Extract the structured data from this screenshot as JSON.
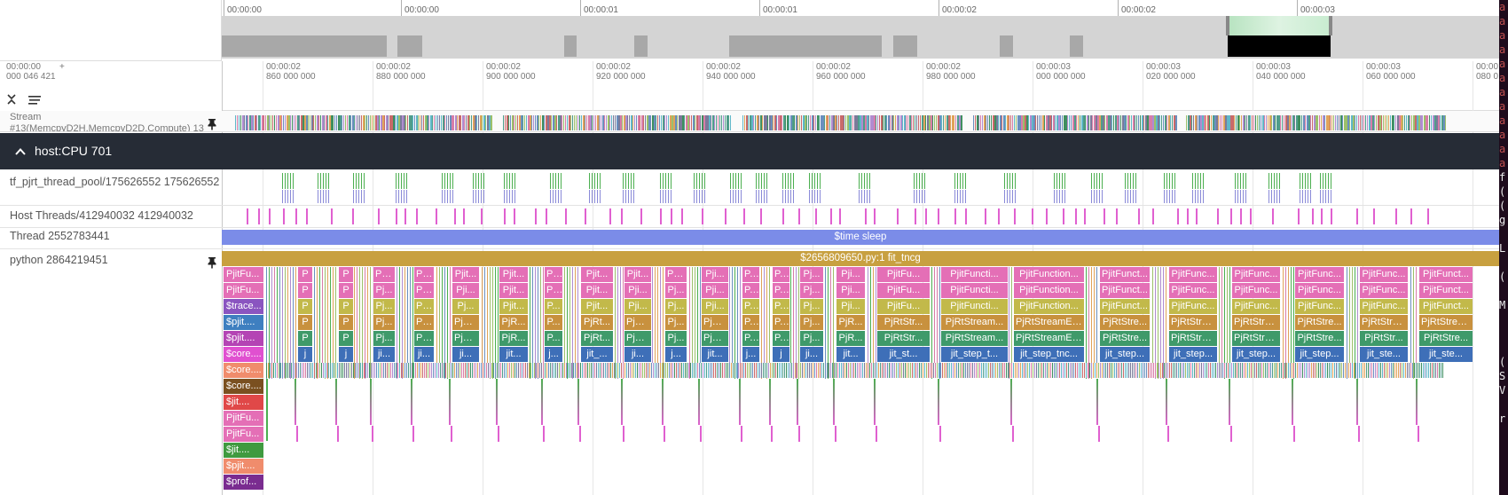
{
  "overview": {
    "ticks": [
      "00:00:00",
      "00:00:00",
      "00:00:01",
      "00:00:01",
      "00:00:02",
      "00:00:02",
      "00:00:03"
    ]
  },
  "ruler": {
    "origin_time": "00:00:00",
    "origin_ns": "000 046 421",
    "plus": "+",
    "labels": [
      {
        "t": "00:00:02",
        "ns": "860 000 000"
      },
      {
        "t": "00:00:02",
        "ns": "880 000 000"
      },
      {
        "t": "00:00:02",
        "ns": "900 000 000"
      },
      {
        "t": "00:00:02",
        "ns": "920 000 000"
      },
      {
        "t": "00:00:02",
        "ns": "940 000 000"
      },
      {
        "t": "00:00:02",
        "ns": "960 000 000"
      },
      {
        "t": "00:00:02",
        "ns": "980 000 000"
      },
      {
        "t": "00:00:03",
        "ns": "000 000 000"
      },
      {
        "t": "00:00:03",
        "ns": "020 000 000"
      },
      {
        "t": "00:00:03",
        "ns": "040 000 000"
      },
      {
        "t": "00:00:03",
        "ns": "060 000 000"
      },
      {
        "t": "00:00:03",
        "ns": "080 0"
      }
    ]
  },
  "tracks": {
    "stream_label": "Stream #13(MemcpyD2H,MemcpyD2D,Compute) 13",
    "group_title": "host:CPU 701",
    "thread_pool": "tf_pjrt_thread_pool/175626552 175626552",
    "host_threads": "Host Threads/412940032 412940032",
    "thread": "Thread 2552783441",
    "python": "python 2864219451"
  },
  "slices": {
    "sleep": "$time sleep",
    "fit": "$2656809650.py:1 fit_tncg",
    "left_column": [
      "PjitFu...",
      "PjitFu...",
      "$trace...",
      "$pjit....",
      "$pjit....",
      "$core....",
      "$core....",
      "$core....",
      "$jit....",
      "PjitFu...",
      "PjitFu...",
      "$jit....",
      "$pjit....",
      "$prof..."
    ],
    "blocks": [
      {
        "r0": "P",
        "r1": "P",
        "r2": "P",
        "r3": "P",
        "r4": "P",
        "r5": "j"
      },
      {
        "r0": "P",
        "r1": "P",
        "r2": "P",
        "r3": "P",
        "r4": "P",
        "r5": "j"
      },
      {
        "r0": "Pjit...",
        "r1": "Pj...",
        "r2": "Pj...",
        "r3": "Pj...",
        "r4": "Pj...",
        "r5": "ji..."
      },
      {
        "r0": "Pj...",
        "r1": "Pj...",
        "r2": "Pj...",
        "r3": "Pj...",
        "r4": "Pj...",
        "r5": "ji..."
      },
      {
        "r0": "Pjit...",
        "r1": "Pji...",
        "r2": "Pj...",
        "r3": "PjR...",
        "r4": "PjR...",
        "r5": "ji..."
      },
      {
        "r0": "Pjit...",
        "r1": "Pjit...",
        "r2": "Pjit...",
        "r3": "PjR...",
        "r4": "PjR...",
        "r5": "jit..."
      },
      {
        "r0": "Pji...",
        "r1": "Pji...",
        "r2": "P...",
        "r3": "P...",
        "r4": "P...",
        "r5": "j..."
      },
      {
        "r0": "Pjit...",
        "r1": "Pjit...",
        "r2": "Pjit...",
        "r3": "PjRt...",
        "r4": "PjRt...",
        "r5": "jit_..."
      },
      {
        "r0": "Pjit...",
        "r1": "Pji...",
        "r2": "Pji...",
        "r3": "PjR...",
        "r4": "PjR...",
        "r5": "ji..."
      },
      {
        "r0": "Pji...",
        "r1": "Pj...",
        "r2": "Pj...",
        "r3": "Pj...",
        "r4": "Pj...",
        "r5": "j..."
      },
      {
        "r0": "Pji...",
        "r1": "Pji...",
        "r2": "Pji...",
        "r3": "PjR...",
        "r4": "PjR...",
        "r5": "jit..."
      },
      {
        "r0": "P...",
        "r1": "P...",
        "r2": "P...",
        "r3": "P...",
        "r4": "P...",
        "r5": "j..."
      },
      {
        "r0": "P...",
        "r1": "P...",
        "r2": "P...",
        "r3": "P...",
        "r4": "P...",
        "r5": "j"
      },
      {
        "r0": "Pj...",
        "r1": "Pj...",
        "r2": "Pj...",
        "r3": "Pj...",
        "r4": "Pj...",
        "r5": "ji..."
      },
      {
        "r0": "Pji...",
        "r1": "Pji...",
        "r2": "Pji...",
        "r3": "PjR...",
        "r4": "PjR...",
        "r5": "jit..."
      },
      {
        "r0": "PjitFu...",
        "r1": "PjitFu...",
        "r2": "PjitFu...",
        "r3": "PjRtStr...",
        "r4": "PjRtStr...",
        "r5": "jit_st..."
      },
      {
        "r0": "PjitFuncti...",
        "r1": "PjitFuncti...",
        "r2": "PjitFuncti...",
        "r3": "PjRtStream...",
        "r4": "PjRtStream...",
        "r5": "jit_step_t..."
      },
      {
        "r0": "PjitFunction...",
        "r1": "PjitFunction...",
        "r2": "PjitFunction...",
        "r3": "PjRtStreamEx...",
        "r4": "PjRtStreamEx...",
        "r5": "jit_step_tnc..."
      },
      {
        "r0": "PjitFunct...",
        "r1": "PjitFunct...",
        "r2": "PjitFunct...",
        "r3": "PjRtStre...",
        "r4": "PjRtStre...",
        "r5": "jit_step..."
      },
      {
        "r0": "PjitFunc...",
        "r1": "PjitFunc...",
        "r2": "PjitFunc...",
        "r3": "PjRtStre...",
        "r4": "PjRtStre...",
        "r5": "jit_step..."
      },
      {
        "r0": "PjitFunc...",
        "r1": "PjitFunc...",
        "r2": "PjitFunc...",
        "r3": "PjRtStre...",
        "r4": "PjRtStre...",
        "r5": "jit_step..."
      },
      {
        "r0": "PjitFunc...",
        "r1": "PjitFunc...",
        "r2": "PjitFunc...",
        "r3": "PjRtStre...",
        "r4": "PjRtStre...",
        "r5": "jit_step..."
      },
      {
        "r0": "PjitFunc...",
        "r1": "PjitFunc...",
        "r2": "PjitFunc...",
        "r3": "PjRtStre...",
        "r4": "PjRtStr...",
        "r5": "jit_ste..."
      },
      {
        "r0": "PjitFunct...",
        "r1": "PjitFunct...",
        "r2": "PjitFunct...",
        "r3": "PjRtStrea...",
        "r4": "PjRtStre...",
        "r5": "jit_ste..."
      }
    ]
  },
  "terminal": {
    "chars": [
      "a",
      "a",
      "a",
      "a",
      "a",
      "a",
      "a",
      "a",
      "a",
      "a",
      "a",
      "a",
      "f",
      "(",
      "(",
      "g",
      "",
      "L",
      "",
      "(",
      "",
      "M",
      "",
      "",
      "",
      "(",
      "S",
      "V",
      "",
      "r"
    ]
  },
  "colors": {
    "accent": "#7b8ce8",
    "group_header": "#262c36",
    "fit_bar": "#c8a040"
  }
}
